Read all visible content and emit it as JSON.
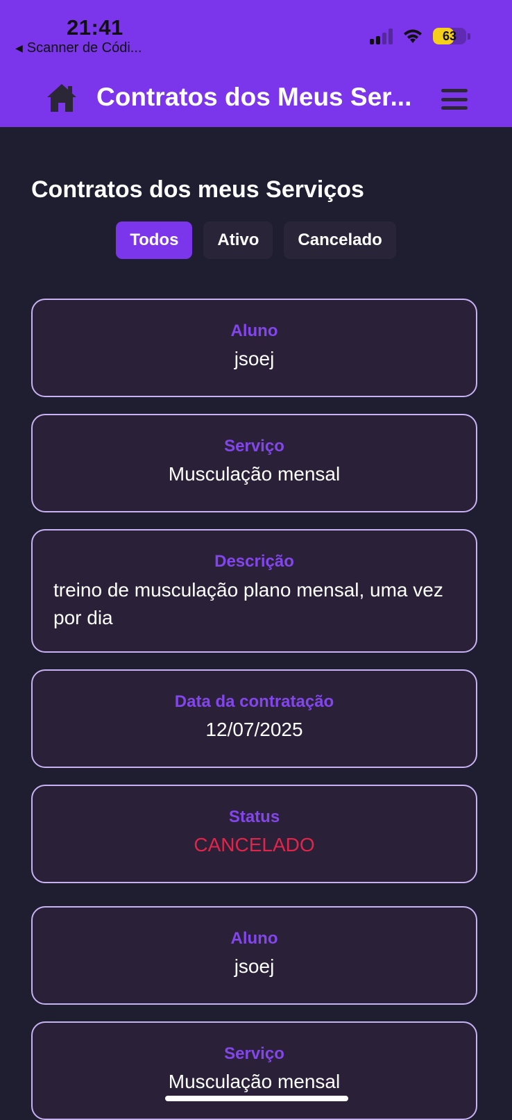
{
  "status_bar": {
    "time": "21:41",
    "back_app": "Scanner de Códi...",
    "battery": "63",
    "battery_level": 0.63
  },
  "header": {
    "title": "Contratos dos Meus Ser..."
  },
  "page": {
    "heading": "Contratos dos meus Serviços"
  },
  "filters": [
    {
      "label": "Todos",
      "active": true
    },
    {
      "label": "Ativo",
      "active": false
    },
    {
      "label": "Cancelado",
      "active": false
    }
  ],
  "contract": {
    "student_label": "Aluno",
    "student": "jsoej",
    "service_label": "Serviço",
    "service": "Musculação mensal",
    "description_label": "Descrição",
    "description": "treino de musculação plano mensal, uma vez por dia",
    "date_label": "Data da contratação",
    "date": "12/07/2025",
    "status_label": "Status",
    "status": "CANCELADO"
  },
  "contract2": {
    "student_label": "Aluno",
    "student": "jsoej",
    "service_label": "Serviço",
    "service": "Musculação mensal"
  },
  "colors": {
    "accent": "#7b35ea",
    "background": "#1f1d30",
    "card": "#2a2138",
    "card_border": "#c7b2f3",
    "label": "#8346ec",
    "status_cancelled": "#e3244a"
  }
}
